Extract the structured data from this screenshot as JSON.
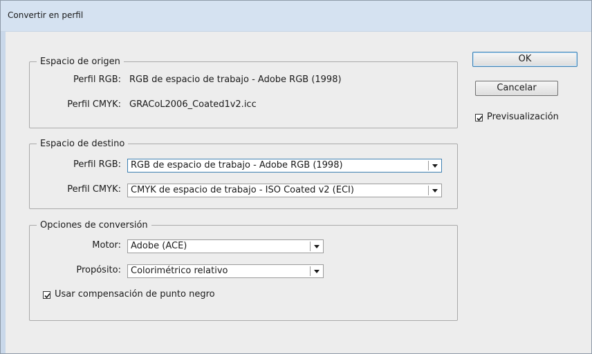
{
  "window": {
    "title": "Convertir en perfil"
  },
  "source_space": {
    "legend": "Espacio de origen",
    "rgb_label": "Perfil RGB:",
    "rgb_value": "RGB de espacio de trabajo - Adobe RGB (1998)",
    "cmyk_label": "Perfil CMYK:",
    "cmyk_value": "GRACoL2006_Coated1v2.icc"
  },
  "dest_space": {
    "legend": "Espacio de destino",
    "rgb_label": "Perfil RGB:",
    "rgb_value": "RGB de espacio de trabajo - Adobe RGB (1998)",
    "cmyk_label": "Perfil CMYK:",
    "cmyk_value": "CMYK de espacio de trabajo - ISO Coated v2 (ECI)"
  },
  "conversion": {
    "legend": "Opciones de conversión",
    "engine_label": "Motor:",
    "engine_value": "Adobe (ACE)",
    "intent_label": "Propósito:",
    "intent_value": "Colorimétrico relativo",
    "black_point_label": "Usar compensación de punto negro",
    "black_point_checked": true
  },
  "buttons": {
    "ok": "OK",
    "cancel": "Cancelar"
  },
  "preview": {
    "label": "Previsualización",
    "checked": true
  }
}
